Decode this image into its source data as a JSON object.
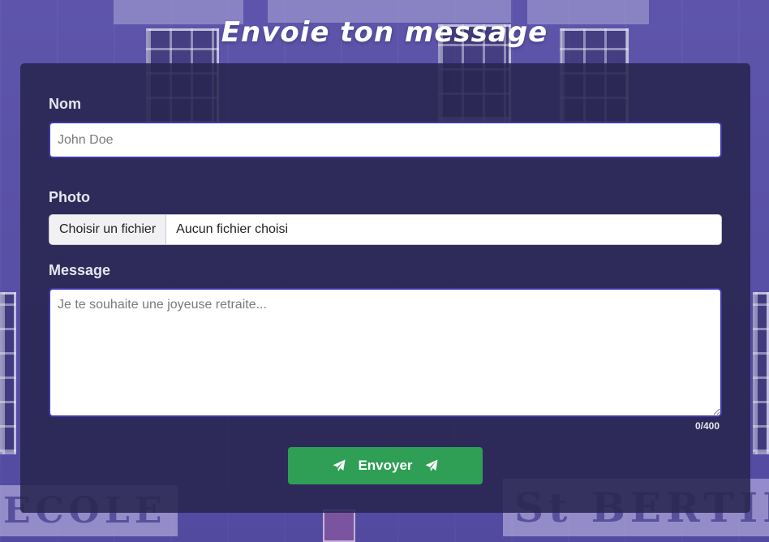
{
  "page": {
    "title": "Envoie ton message"
  },
  "form": {
    "name": {
      "label": "Nom",
      "placeholder": "John Doe",
      "value": ""
    },
    "photo": {
      "label": "Photo",
      "choose_button": "Choisir un fichier",
      "file_status": "Aucun fichier choisi"
    },
    "message": {
      "label": "Message",
      "placeholder": "Je te souhaite une joyeuse retraite...",
      "value": "",
      "counter": "0/400"
    },
    "submit": {
      "label": "Envoyer",
      "icon": "paper-plane-icon"
    }
  },
  "background": {
    "sign_left": "ECOLE",
    "sign_right": "St  BERTIN"
  },
  "colors": {
    "accent_border": "#3f38a8",
    "submit_bg": "#2e9f55",
    "card_bg": "rgba(40,38,80,0.88)",
    "background_tint": "#6259ad"
  }
}
